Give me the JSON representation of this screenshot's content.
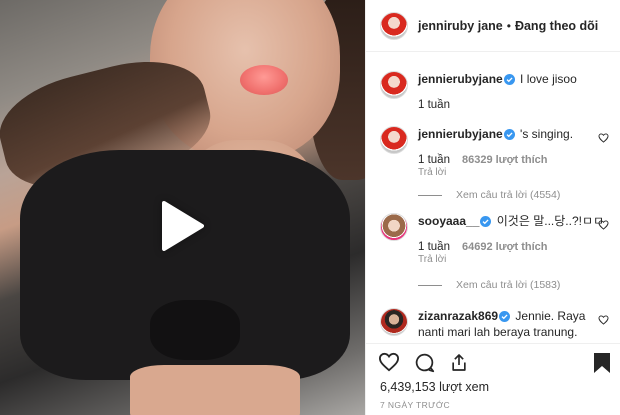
{
  "post": {
    "author": "jenniruby jane",
    "follow_status": "Đang theo dõi",
    "separator": "•"
  },
  "comments": [
    {
      "username": "jennierubyjane",
      "verified": true,
      "text": "I love jisoo",
      "time": "1 tuần",
      "likes": "",
      "reply": ""
    },
    {
      "username": "jennierubyjane",
      "verified": true,
      "text": "'s singing.",
      "time": "1 tuần",
      "likes": "86329 lượt thích",
      "reply": "Trả lời",
      "view_replies": "Xem câu trả lời (4554)"
    },
    {
      "username": "sooyaaa__",
      "verified": true,
      "text": "이것은 말...당..?!ㅁㅁ",
      "time": "1 tuần",
      "likes": "64692 lượt thích",
      "reply": "Trả lời",
      "view_replies": "Xem câu trả lời (1583)"
    },
    {
      "username": "zizanrazak869",
      "verified": true,
      "text": "Jennie. Raya nanti mari lah beraya tranung.",
      "time": "",
      "likes": "",
      "reply": ""
    }
  ],
  "actions": {
    "views": "6,439,153 lượt xem",
    "date": "7 NGÀY TRƯỚC"
  },
  "icons": {
    "play": "play-icon",
    "verified": "verified-badge-icon",
    "heart": "heart-icon",
    "comment": "comment-icon",
    "share": "share-icon",
    "bookmark": "bookmark-icon"
  },
  "colors": {
    "verified": "#3897f0",
    "text": "#262626",
    "muted": "#8e8e8e"
  }
}
